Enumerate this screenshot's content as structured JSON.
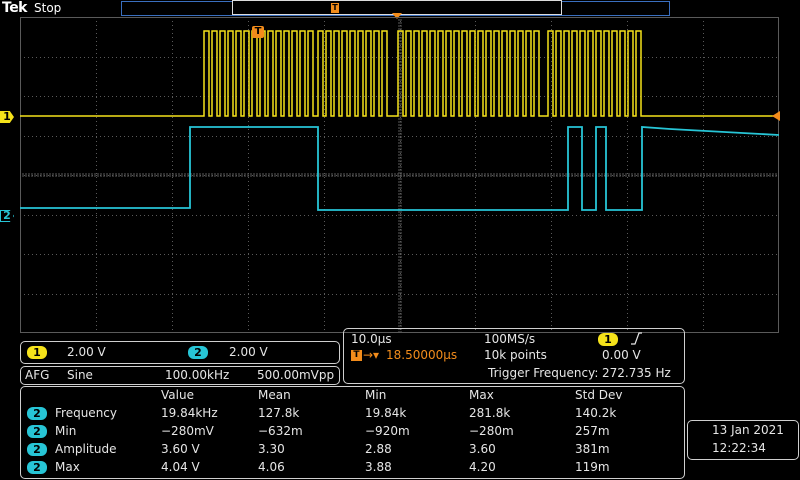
{
  "header": {
    "brand": "Tek",
    "run_state": "Stop"
  },
  "trigger_pos_marker": "T",
  "channels": {
    "ch1_label": "1",
    "ch2_label": "2"
  },
  "colors": {
    "ch1": "#f5e21a",
    "ch2": "#27c5d6",
    "trigger": "#f28c1b",
    "grid": "#5a5a5a"
  },
  "vertical_panel": {
    "ch1_scale": "2.00 V",
    "ch2_scale": "2.00 V"
  },
  "afg": {
    "label": "AFG",
    "waveform": "Sine",
    "frequency": "100.00kHz",
    "amplitude": "500.00mVpp"
  },
  "horizontal_panel": {
    "time_per_div": "10.0µs",
    "sample_rate": "100MS/s",
    "trigger_source": "1",
    "trigger_slope_icon": "rising-edge-icon",
    "trigger_position": "18.50000µs",
    "record_length": "10k points",
    "trigger_level": "0.00 V",
    "trigger_frequency_label": "Trigger Frequency:",
    "trigger_frequency": "272.735 Hz"
  },
  "measurements": {
    "columns": [
      "Value",
      "Mean",
      "Min",
      "Max",
      "Std Dev"
    ],
    "rows": [
      {
        "ch": "2",
        "name": "Frequency",
        "value": "19.84kHz",
        "mean": "127.8k",
        "min": "19.84k",
        "max": "281.8k",
        "std": "140.2k"
      },
      {
        "ch": "2",
        "name": "Min",
        "value": "−280mV",
        "mean": "−632m",
        "min": "−920m",
        "max": "−280m",
        "std": "257m"
      },
      {
        "ch": "2",
        "name": "Amplitude",
        "value": "3.60 V",
        "mean": "3.30",
        "min": "2.88",
        "max": "3.60",
        "std": "381m"
      },
      {
        "ch": "2",
        "name": "Max",
        "value": "4.04 V",
        "mean": "4.06",
        "min": "3.88",
        "max": "4.20",
        "std": "119m"
      }
    ]
  },
  "datetime": {
    "date": "13 Jan  2021",
    "time": "12:22:34"
  }
}
